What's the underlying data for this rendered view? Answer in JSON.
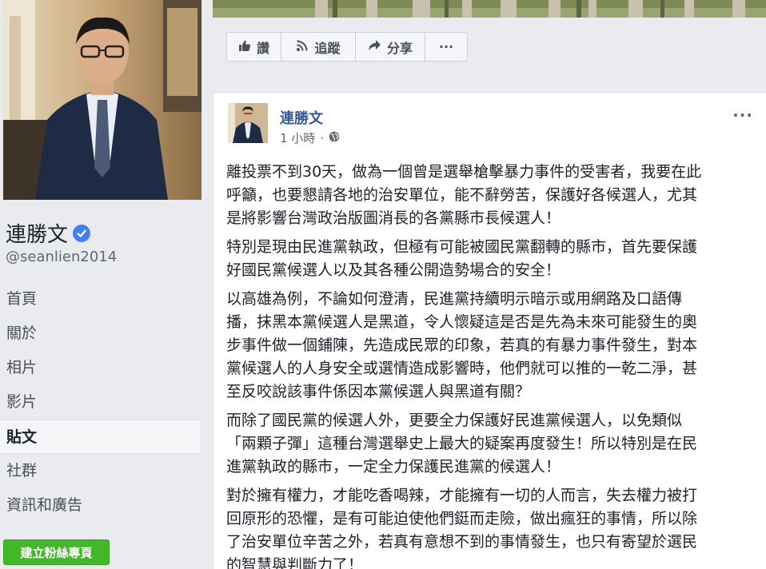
{
  "page": {
    "name": "連勝文",
    "handle": "@seanlien2014"
  },
  "nav": {
    "items": [
      {
        "label": "首頁"
      },
      {
        "label": "關於"
      },
      {
        "label": "相片"
      },
      {
        "label": "影片"
      },
      {
        "label": "貼文",
        "active": true
      },
      {
        "label": "社群"
      },
      {
        "label": "資訊和廣告"
      }
    ]
  },
  "create_page_button": "建立粉絲專頁",
  "actions": {
    "like": "讚",
    "follow": "追蹤",
    "share": "分享",
    "more": "···"
  },
  "post": {
    "author": "連勝文",
    "time": "1 小時",
    "separator": "·",
    "privacy_icon": "globe-icon",
    "menu": "···",
    "paragraphs": [
      "離投票不到30天，做為一個曾是選舉槍擊暴力事件的受害者，我要在此\n呼籲，也要懇請各地的治安單位，能不辭勞苦，保護好各候選人，尤其\n是將影響台灣政治版圖消長的各黨縣市長候選人！",
      "特別是現由民進黨執政，但極有可能被國民黨翻轉的縣市，首先要保護\n好國民黨候選人以及其各種公開造勢場合的安全！",
      "以高雄為例，不論如何澄清，民進黨持續明示暗示或用網路及口語傳\n播，抹黑本黨候選人是黑道，令人懷疑這是否是先為未來可能發生的奧\n步事件做一個鋪陳，先造成民眾的印象，若真的有暴力事件發生，對本\n黨候選人的人身安全或選情造成影響時，他們就可以推的一乾二淨，甚\n至反咬說該事件係因本黨候選人與黑道有關？",
      "而除了國民黨的候選人外，更要全力保護好民進黨候選人，以免類似\n「兩顆子彈」這種台灣選舉史上最大的疑案再度發生！所以特別是在民\n進黨執政的縣市，一定全力保護民進黨的候選人！",
      "對於擁有權力，才能吃香喝辣，才能擁有一切的人而言，失去權力被打\n回原形的恐懼，是有可能迫使他們鋌而走險，做出瘋狂的事情，所以除\n了治安單位辛苦之外，若真有意想不到的事情發生，也只有寄望於選民\n的智慧與判斷力了！"
    ]
  },
  "colors": {
    "link_blue": "#385898",
    "verified_blue": "#4080ff",
    "create_green": "#42b72a",
    "background": "#e9ebee"
  }
}
